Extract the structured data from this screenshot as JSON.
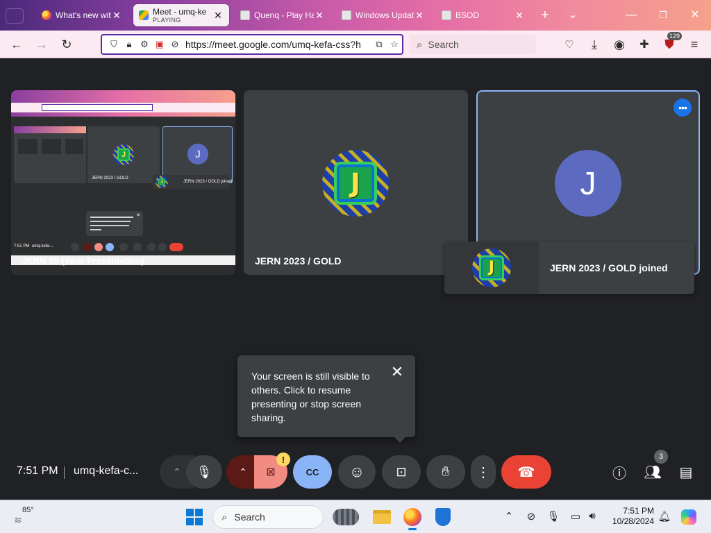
{
  "browser": {
    "tabs": [
      {
        "title": "What's new with",
        "favicon": "firefox-icon",
        "active": false
      },
      {
        "title": "Meet - umq-ke",
        "subtitle": "PLAYING",
        "favicon": "google-meet-icon",
        "active": true
      },
      {
        "title": "Quenq - Play Ha",
        "favicon": "generic-page-icon",
        "active": false
      },
      {
        "title": "Windows Updat",
        "favicon": "generic-page-icon",
        "active": false
      },
      {
        "title": "BSOD",
        "favicon": "generic-page-icon",
        "active": false
      }
    ],
    "new_tab_label": "+",
    "url": "https://meet.google.com/umq-kefa-css?h",
    "search_placeholder": "Search",
    "extensions_badge": "129"
  },
  "meet": {
    "tiles": {
      "share_label": "JERN 99 (Your Presentation)",
      "participant_name": "JERN 2023 / GOLD",
      "j_avatar_letter": "J",
      "blue_avatar_letter": "J"
    },
    "mini": {
      "tile_name": "JERN 2023 / GOLD",
      "joined": "JERN 2023 / GOLD joined",
      "clock": "7:51 PM",
      "code": "umq-kefa-..."
    },
    "joined_toast": "JERN 2023 / GOLD joined",
    "screen_popup": {
      "message": "Your screen is still visible to others. Click to resume presenting or stop screen sharing.",
      "close": "✕"
    },
    "controls": {
      "time": "7:51 PM",
      "meeting_code": "umq-kefa-c...",
      "warning_mark": "!",
      "people_count": "3"
    },
    "colors": {
      "end_call": "#ea4335",
      "captions_on": "#8ab4f8",
      "camera_off": "#f28b82",
      "avatar_blue": "#5c6bc0",
      "tile_bg": "#3c4043"
    }
  },
  "taskbar": {
    "temperature": "85°",
    "search_label": "Search",
    "time": "7:51 PM",
    "date": "10/28/2024"
  }
}
